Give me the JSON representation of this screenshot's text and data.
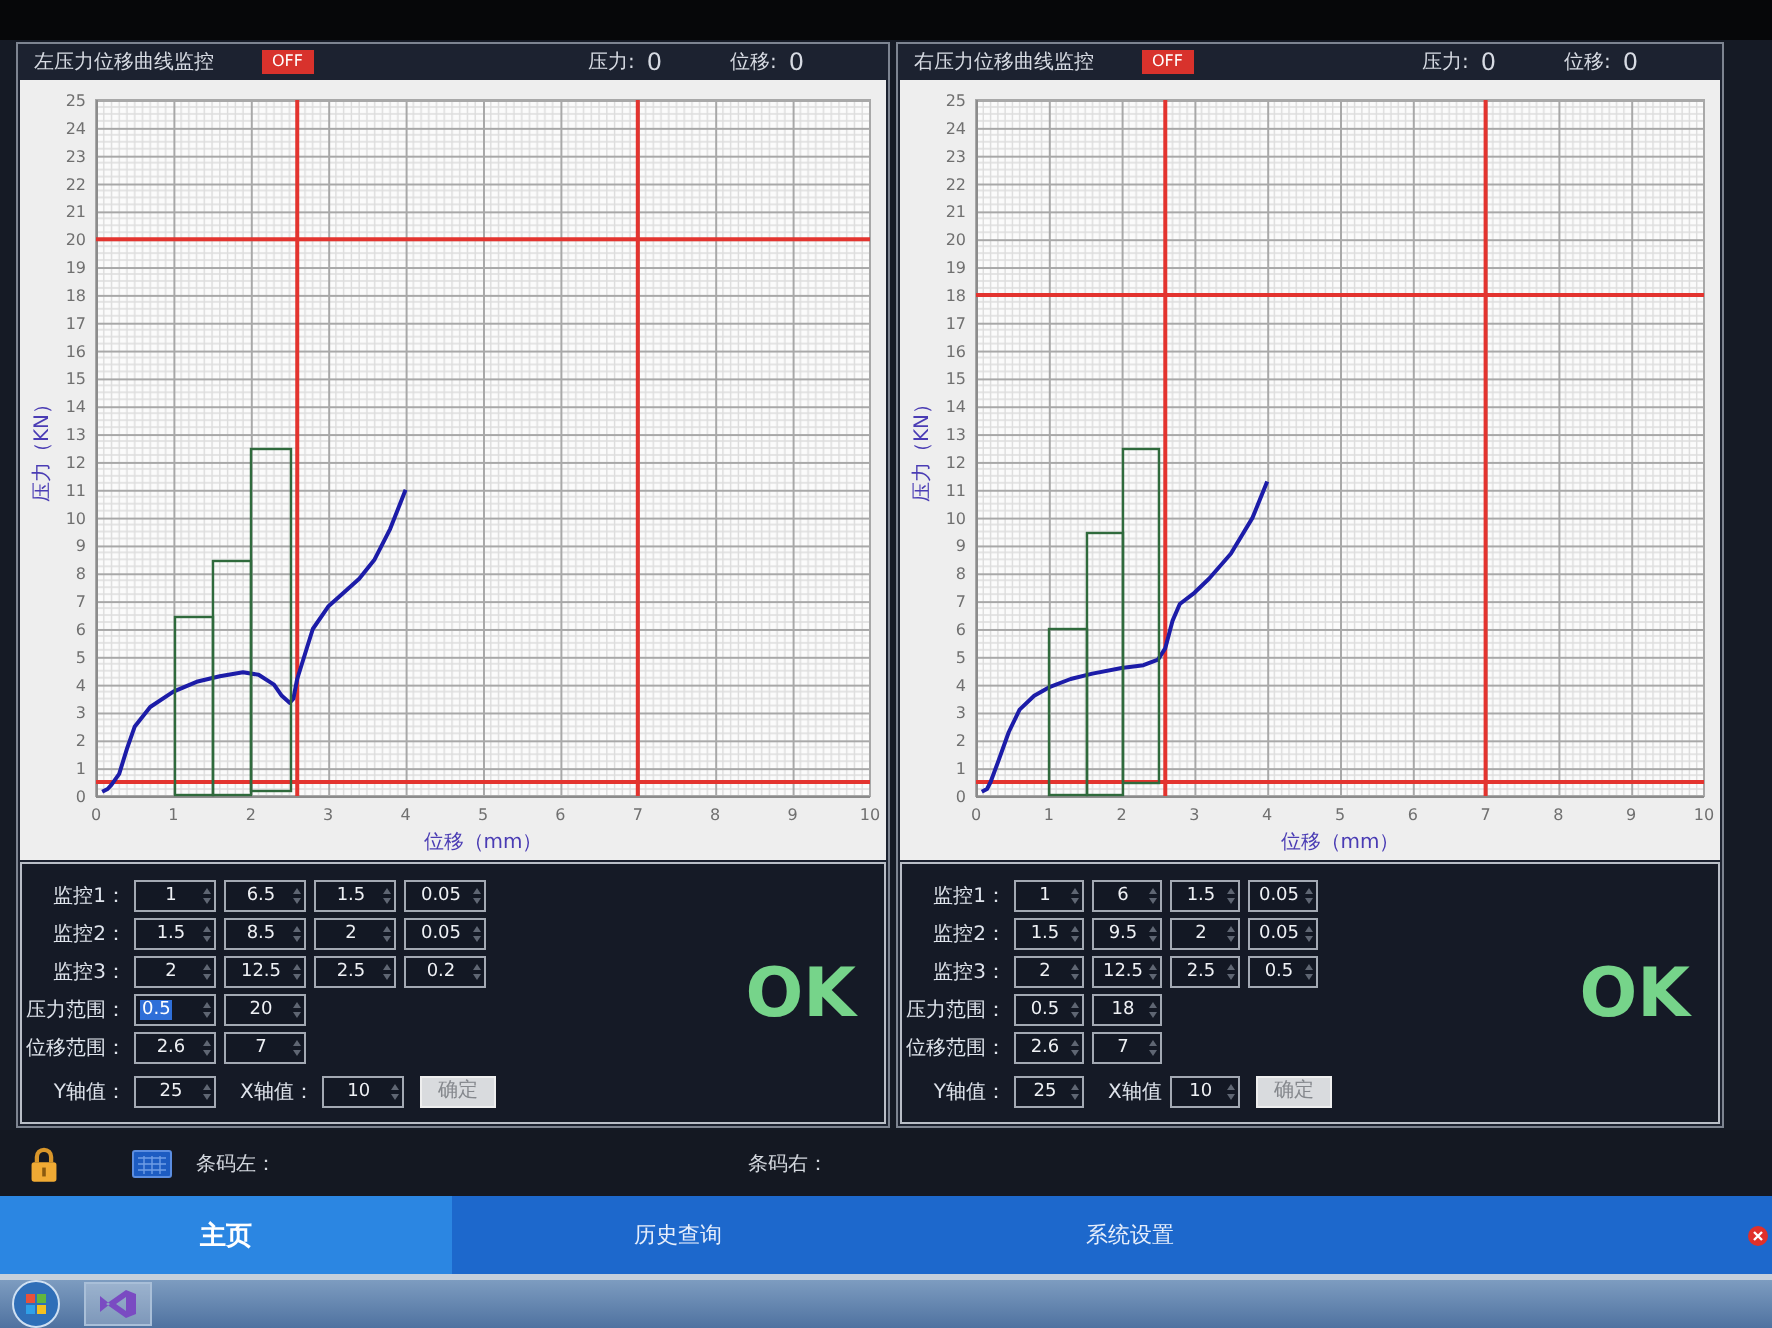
{
  "panels": [
    {
      "title": "左压力位移曲线监控",
      "switch": {
        "label": "OFF",
        "on": false
      },
      "readouts": [
        {
          "label": "压力:",
          "value": "0"
        },
        {
          "label": "位移:",
          "value": "0"
        }
      ],
      "chart_data": {
        "type": "line",
        "xlabel": "位移（mm）",
        "ylabel": "压力（KN）",
        "x": [
          0.08,
          0.15,
          0.2,
          0.3,
          0.4,
          0.5,
          0.7,
          1,
          1.3,
          1.6,
          1.9,
          2.1,
          2.3,
          2.4,
          2.5,
          2.55,
          2.6,
          2.7,
          2.8,
          3,
          3.2,
          3.4,
          3.6,
          3.8,
          4
        ],
        "series": [
          {
            "color": "#1c1ca8",
            "values": [
              0.15,
              0.25,
              0.4,
              0.8,
              1.7,
              2.5,
              3.2,
              3.75,
              4.1,
              4.3,
              4.45,
              4.35,
              4.0,
              3.6,
              3.35,
              3.5,
              4.2,
              5.1,
              6.0,
              6.8,
              7.3,
              7.8,
              8.5,
              9.6,
              11.0
            ]
          }
        ],
        "xlim": [
          0,
          10
        ],
        "ylim": [
          0,
          25
        ],
        "xticks": [
          0,
          1,
          2,
          3,
          4,
          5,
          6,
          7,
          8,
          9,
          10
        ],
        "yticks": [
          0,
          1,
          2,
          3,
          4,
          5,
          6,
          7,
          8,
          9,
          10,
          11,
          12,
          13,
          14,
          15,
          16,
          17,
          18,
          19,
          20,
          21,
          22,
          23,
          24,
          25
        ],
        "ref_lines": [
          {
            "axis": "y",
            "value": 0.5
          },
          {
            "axis": "y",
            "value": 20
          },
          {
            "axis": "x",
            "value": 2.6
          },
          {
            "axis": "x",
            "value": 7
          }
        ]
      },
      "controls": {
        "rows": [
          {
            "label": "监控1：",
            "fields": [
              {
                "value": "1",
                "highlighted": false
              },
              {
                "value": "6.5",
                "highlighted": false
              },
              {
                "value": "1.5",
                "highlighted": false
              },
              {
                "value": "0.05",
                "highlighted": false
              }
            ]
          },
          {
            "label": "监控2：",
            "fields": [
              {
                "value": "1.5",
                "highlighted": false
              },
              {
                "value": "8.5",
                "highlighted": false
              },
              {
                "value": "2",
                "highlighted": false
              },
              {
                "value": "0.05",
                "highlighted": false
              }
            ]
          },
          {
            "label": "监控3：",
            "fields": [
              {
                "value": "2",
                "highlighted": false
              },
              {
                "value": "12.5",
                "highlighted": false
              },
              {
                "value": "2.5",
                "highlighted": false
              },
              {
                "value": "0.2",
                "highlighted": false
              }
            ]
          },
          {
            "label": "压力范围：",
            "fields": [
              {
                "value": "0.5",
                "highlighted": true
              },
              {
                "value": "20",
                "highlighted": false
              }
            ]
          },
          {
            "label": "位移范围：",
            "fields": [
              {
                "value": "2.6",
                "highlighted": false
              },
              {
                "value": "7",
                "highlighted": false
              }
            ]
          }
        ],
        "axis_row": {
          "items": [
            {
              "label": "Y轴值：",
              "field": {
                "value": "25",
                "highlighted": false
              }
            },
            {
              "label": "X轴值：",
              "field": {
                "value": "10",
                "highlighted": false
              }
            }
          ],
          "button": "确定"
        }
      },
      "result": {
        "text": "OK",
        "pass": true
      }
    },
    {
      "title": "右压力位移曲线监控",
      "switch": {
        "label": "OFF",
        "on": false
      },
      "readouts": [
        {
          "label": "压力:",
          "value": "0"
        },
        {
          "label": "位移:",
          "value": "0"
        }
      ],
      "chart_data": {
        "type": "line",
        "xlabel": "位移（mm）",
        "ylabel": "压力（KN）",
        "x": [
          0.08,
          0.15,
          0.2,
          0.3,
          0.45,
          0.6,
          0.8,
          1,
          1.3,
          1.6,
          2,
          2.3,
          2.5,
          2.6,
          2.7,
          2.8,
          3,
          3.2,
          3.5,
          3.8,
          4
        ],
        "series": [
          {
            "color": "#1c1ca8",
            "values": [
              0.15,
              0.25,
              0.5,
              1.2,
              2.3,
              3.1,
              3.6,
              3.9,
              4.2,
              4.4,
              4.6,
              4.7,
              4.9,
              5.3,
              6.3,
              6.9,
              7.3,
              7.8,
              8.7,
              10.0,
              11.3
            ]
          }
        ],
        "xlim": [
          0,
          10
        ],
        "ylim": [
          0,
          25
        ],
        "xticks": [
          0,
          1,
          2,
          3,
          4,
          5,
          6,
          7,
          8,
          9,
          10
        ],
        "yticks": [
          0,
          1,
          2,
          3,
          4,
          5,
          6,
          7,
          8,
          9,
          10,
          11,
          12,
          13,
          14,
          15,
          16,
          17,
          18,
          19,
          20,
          21,
          22,
          23,
          24,
          25
        ],
        "ref_lines": [
          {
            "axis": "y",
            "value": 0.5
          },
          {
            "axis": "y",
            "value": 18
          },
          {
            "axis": "x",
            "value": 2.6
          },
          {
            "axis": "x",
            "value": 7
          }
        ]
      },
      "controls": {
        "rows": [
          {
            "label": "监控1：",
            "fields": [
              {
                "value": "1",
                "highlighted": false
              },
              {
                "value": "6",
                "highlighted": false
              },
              {
                "value": "1.5",
                "highlighted": false
              },
              {
                "value": "0.05",
                "highlighted": false
              }
            ]
          },
          {
            "label": "监控2：",
            "fields": [
              {
                "value": "1.5",
                "highlighted": false
              },
              {
                "value": "9.5",
                "highlighted": false
              },
              {
                "value": "2",
                "highlighted": false
              },
              {
                "value": "0.05",
                "highlighted": false
              }
            ]
          },
          {
            "label": "监控3：",
            "fields": [
              {
                "value": "2",
                "highlighted": false
              },
              {
                "value": "12.5",
                "highlighted": false
              },
              {
                "value": "2.5",
                "highlighted": false
              },
              {
                "value": "0.5",
                "highlighted": false
              }
            ]
          },
          {
            "label": "压力范围：",
            "fields": [
              {
                "value": "0.5",
                "highlighted": false
              },
              {
                "value": "18",
                "highlighted": false
              }
            ]
          },
          {
            "label": "位移范围：",
            "fields": [
              {
                "value": "2.6",
                "highlighted": false
              },
              {
                "value": "7",
                "highlighted": false
              }
            ]
          }
        ],
        "axis_row": {
          "items": [
            {
              "label": "Y轴值：",
              "field": {
                "value": "25",
                "highlighted": false
              }
            },
            {
              "label": "X轴值",
              "field": {
                "value": "10",
                "highlighted": false
              }
            }
          ],
          "button": "确定"
        }
      },
      "result": {
        "text": "OK",
        "pass": true
      }
    }
  ],
  "status_bar": {
    "labels": [
      "条码左：",
      "条码右："
    ]
  },
  "nav": {
    "tabs": [
      {
        "label": "主页",
        "selected": true
      },
      {
        "label": "历史查询",
        "selected": false
      },
      {
        "label": "系统设置",
        "selected": false
      }
    ]
  }
}
